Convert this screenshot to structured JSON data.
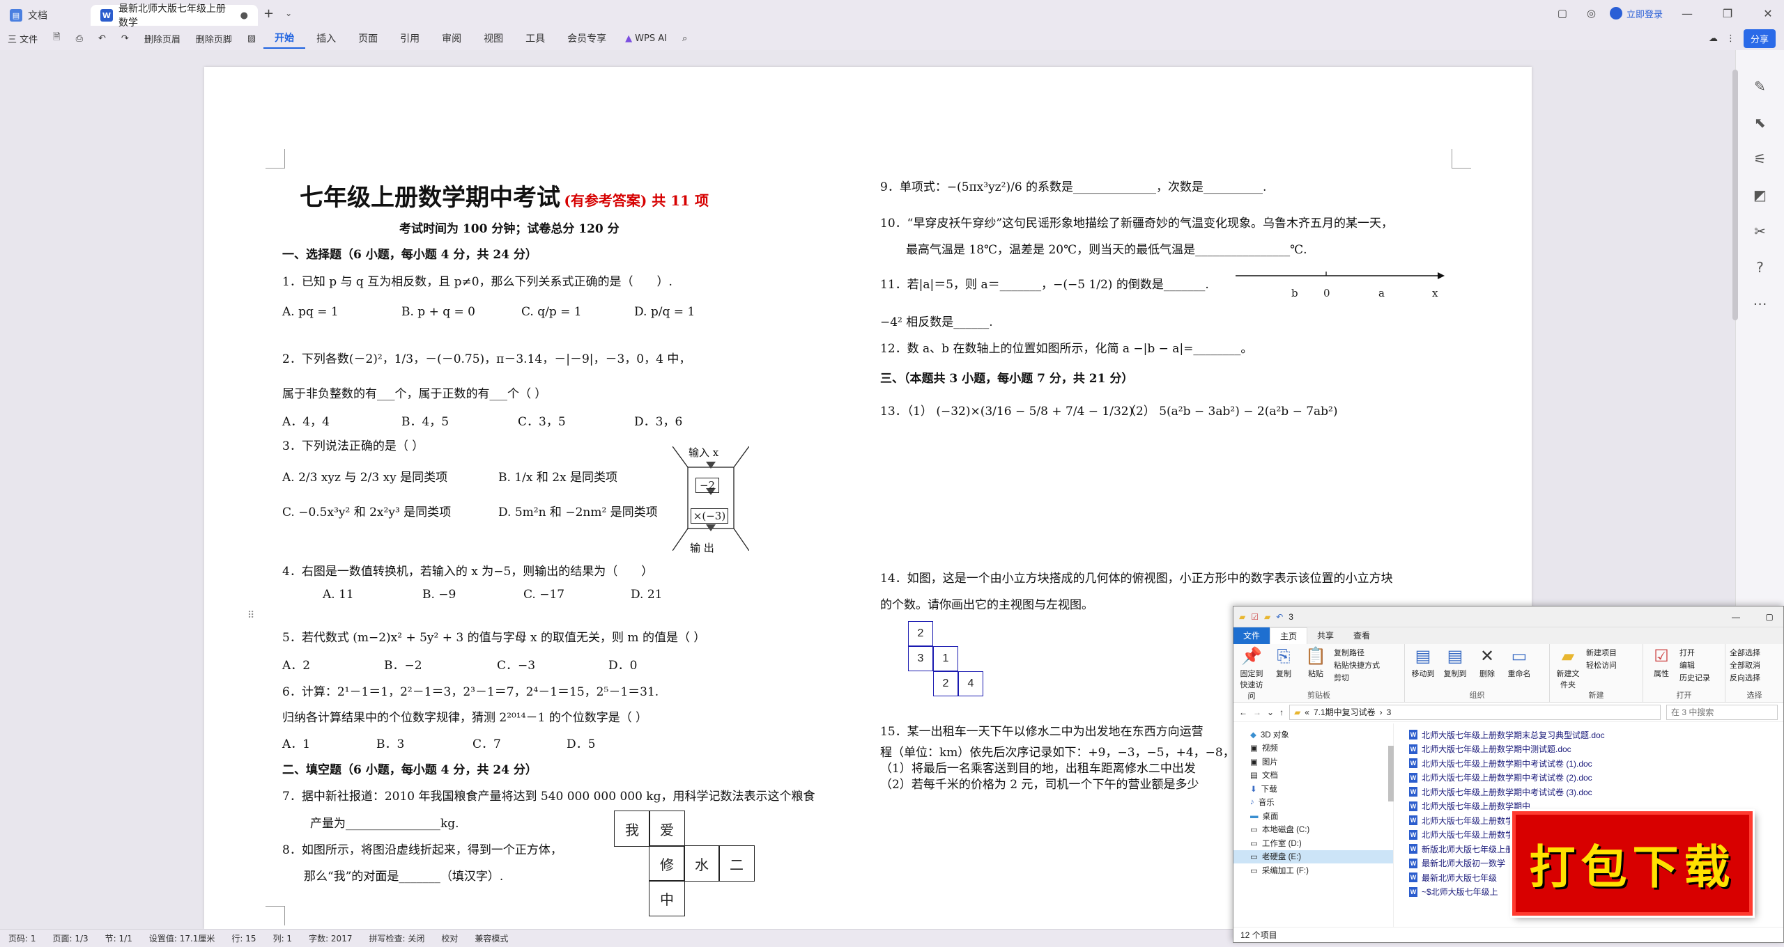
{
  "titlebar": {
    "tab1": "文档",
    "tab2": "最新北师大版七年级上册数学",
    "new_tab": "+",
    "login": "立即登录"
  },
  "ribbon": {
    "file": "三 文件",
    "delete_header": "删除页眉",
    "delete_footer": "删除页脚",
    "tabs": [
      "开始",
      "插入",
      "页面",
      "引用",
      "审阅",
      "视图",
      "工具",
      "会员专享"
    ],
    "wps_ai": "WPS AI",
    "share": "分享"
  },
  "doc": {
    "title": "七年级上册数学期中考试",
    "title_red": "(有参考答案) 共 11 项",
    "subtitle": "考试时间为 100 分钟；试卷总分 120 分",
    "sec1": "一、选择题（6 小题，每小题 4 分，共 24 分）",
    "q1": "1．已知 p 与 q 互为相反数，且 p≠0，那么下列关系式正确的是（　　）.",
    "q1_opts": [
      "A.  pq = 1",
      "B.  p + q = 0",
      "C.  q/p = 1",
      "D.  p/q = 1"
    ],
    "q2": "2．下列各数(－2)²，1/3，－(－0.75)，π－3.14，－|－9|，－3，0，4 中，",
    "q2b": "属于非负整数的有___个，属于正数的有___个（ ）",
    "q2_opts": [
      "A．4，4",
      "B．4，5",
      "C．3，5",
      "D．3，6"
    ],
    "q3": "3．下列说法正确的是（ ）",
    "q3_a": "A.  2/3 xyz 与 2/3 xy 是同类项",
    "q3_b": "B.  1/x 和 2x 是同类项",
    "q3_c": "C.  −0.5x³y² 和 2x²y³ 是同类项",
    "q3_d": "D.  5m²n 和 −2nm² 是同类项",
    "machine_in": "输入 x",
    "machine_op1": "−2",
    "machine_op2": "×(−3)",
    "machine_out": "输  出",
    "q4": "4．右图是一数值转换机，若输入的 x 为−5，则输出的结果为（　　）",
    "q4_opts": [
      "A. 11",
      "B. −9",
      "C. −17",
      "D. 21"
    ],
    "q5": "5．若代数式 (m−2)x² + 5y² + 3 的值与字母 x 的取值无关，则 m 的值是（ ）",
    "q5_opts": [
      "A．2",
      "B．−2",
      "C．−3",
      "D．0"
    ],
    "q6": "6．计算：2¹－1＝1，2²－1＝3，2³－1＝7，2⁴－1＝15，2⁵－1＝31.",
    "q6b": "归纳各计算结果中的个位数字规律，猜测 2²⁰¹⁴－1 的个位数字是（ ）",
    "q6_opts": [
      "A．1",
      "B．3",
      "C．7",
      "D．5"
    ],
    "sec2": "二、填空题（6 小题，每小题 4 分，共 24 分）",
    "q7": "7．据中新社报道：2010 年我国粮食产量将达到 540 000 000 000 kg，用科学记数法表示这个粮食",
    "q7b": "产量为________________kg.",
    "q8": "8．如图所示，将图沿虚线折起来，得到一个正方体，",
    "q8b": "那么“我”的对面是_______（填汉字）.",
    "net": [
      "我",
      "爱",
      "修",
      "水",
      "二",
      "中"
    ],
    "q9": "9．单项式：−(5πx³yz²)/6 的系数是______________，次数是__________.",
    "q10": "10．“早穿皮袄午穿纱”这句民谣形象地描绘了新疆奇妙的气温变化现象。乌鲁木齐五月的某一天，",
    "q10b": "最高气温是 18℃，温差是 20℃，则当天的最低气温是________________℃.",
    "q11": "11．若|a|＝5，则 a＝_______，−(−5 1/2) 的倒数是_______.",
    "q11b": "−4² 相反数是______.",
    "numline": [
      "b",
      "0",
      "a",
      "x"
    ],
    "q12": "12．数 a、b 在数轴上的位置如图所示，化简  a −|b − a|=________。",
    "sec3": "三、（本题共 3 小题，每小题 7 分，共 21 分）",
    "q13a": "13．（1） (−32)×(3/16 − 5/8 + 7/4 − 1/32)",
    "q13b": "（2） 5(a²b − 3ab²) − 2(a²b − 7ab²)",
    "q14": "14．如图，这是一个由小立方块搭成的几何体的俯视图，小正方形中的数字表示该位置的小立方块",
    "q14b": "的个数。请你画出它的主视图与左视图。",
    "grid": [
      "2",
      "3",
      "1",
      "2",
      "4"
    ],
    "q15": "15．某一出租车一天下午以修水二中为出发地在东西方向运营",
    "q15b": "程（单位：km）依先后次序记录如下：+9，−3，−5，+4，−8，",
    "q15c": "（1）将最后一名乘客送到目的地，出租车距离修水二中出发",
    "q15d": "（2）若每千米的价格为 2 元，司机一个下午的营业额是多少"
  },
  "statusbar": {
    "page": "页码: 1",
    "pages": "页面: 1/3",
    "section": "节: 1/1",
    "setting": "设置值: 17.1厘米",
    "row": "行: 15",
    "col": "列: 1",
    "words": "字数: 2017",
    "spell": "拼写检查: 关闭",
    "proof": "校对",
    "compat": "兼容模式"
  },
  "explorer": {
    "title": "3",
    "tabs": [
      "文件",
      "主页",
      "共享",
      "查看"
    ],
    "pin": "固定到快速访问",
    "copy": "复制",
    "paste": "粘贴",
    "copy_path": "复制路径",
    "paste_shortcut": "粘贴快捷方式",
    "cut": "剪切",
    "clipboard": "剪贴板",
    "move_to": "移动到",
    "copy_to": "复制到",
    "delete": "删除",
    "rename": "重命名",
    "organize": "组织",
    "new_folder": "新建文件夹",
    "new_item": "新建项目",
    "easy_access": "轻松访问",
    "new": "新建",
    "properties": "属性",
    "open": "打开",
    "edit": "编辑",
    "history": "历史记录",
    "open_group": "打开",
    "select_all": "全部选择",
    "select_none": "全部取消",
    "invert": "反向选择",
    "select": "选择",
    "path1": "7.1期中复习试卷",
    "path2": "3",
    "search": "在 3 中搜索",
    "nav": [
      "3D 对象",
      "视频",
      "图片",
      "文档",
      "下载",
      "音乐",
      "桌面",
      "本地磁盘 (C:)",
      "工作室 (D:)",
      "老硬盘 (E:)",
      "采编加工 (F:)"
    ],
    "files": [
      "北师大版七年级上册数学期末总复习典型试题.doc",
      "北师大版七年级上册数学期中测试题.doc",
      "北师大版七年级上册数学期中考试试卷 (1).doc",
      "北师大版七年级上册数学期中考试试卷 (2).doc",
      "北师大版七年级上册数学期中考试试卷 (3).doc",
      "北师大版七年级上册数学期中",
      "北师大版七年级上册数学期中",
      "北师大版七年级上册数学期中",
      "新版北师大版七年级上册数",
      "最新北师大版初一数学",
      "最新北师大版七年级",
      "~$北师大版七年级上"
    ],
    "count": "12 个项目"
  },
  "badge": "打包下载"
}
